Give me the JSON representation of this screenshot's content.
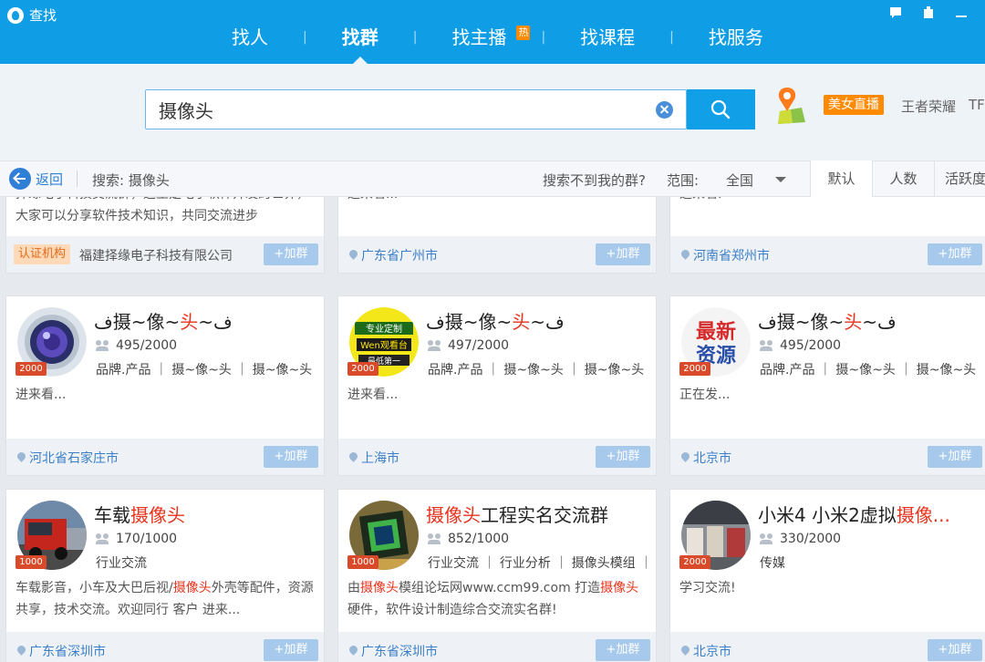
{
  "app": {
    "title": "查找"
  },
  "nav": {
    "items": [
      {
        "label": "找人"
      },
      {
        "label": "找群"
      },
      {
        "label": "找主播",
        "badge": "热"
      },
      {
        "label": "找课程"
      },
      {
        "label": "找服务"
      }
    ],
    "active_index": 1
  },
  "search": {
    "value": "摄像头",
    "placeholder": ""
  },
  "promo": {
    "badge": "美女直播",
    "links": [
      "王者荣耀",
      "TF"
    ]
  },
  "filter": {
    "back_label": "返回",
    "search_term": "搜索: 摄像头",
    "not_found": "搜索不到我的群?",
    "scope_label": "范围:",
    "scope_value": "全国",
    "sort_tabs": [
      "默认",
      "人数",
      "活跃度"
    ]
  },
  "results": {
    "join_label": "+加群",
    "top_row": [
      {
        "desc": "择缘电子科技交流群，这里是电子软件开发的世界，大家可以分享软件技术知识，共同交流进步",
        "cert_badge": "认证机构",
        "org": "福建择缘电子科技有限公司"
      },
      {
        "desc": "进来看...",
        "location": "广东省广州市"
      },
      {
        "desc": "进来看.",
        "location": "河南省郑州市"
      }
    ],
    "groups": [
      {
        "name_parts": [
          "ف摄~像~",
          "头",
          "~ف"
        ],
        "members": "495/2000",
        "tags": "品牌.产品 ｜ 摄~像~头 ｜ 摄~像~头",
        "desc": "进来看...",
        "location": "河北省石家庄市",
        "capacity": "2000"
      },
      {
        "name_parts": [
          "ف摄~像~",
          "头",
          "~ف"
        ],
        "members": "497/2000",
        "tags": "品牌.产品 ｜ 摄~像~头 ｜ 摄~像~头",
        "desc": "进来看...",
        "location": "上海市",
        "capacity": "2000"
      },
      {
        "name_parts": [
          "ف摄~像~",
          "头",
          "~ف"
        ],
        "members": "495/2000",
        "tags": "品牌.产品 ｜ 摄~像~头 ｜ 摄~像~头",
        "desc": "正在发...",
        "location": "北京市",
        "capacity": "2000"
      },
      {
        "name_parts": [
          "车载",
          "摄像头",
          ""
        ],
        "members": "170/1000",
        "tags": "行业交流",
        "desc_parts": [
          "车载影音，小车及大巴后视/",
          "摄像头",
          "外壳等配件，资源共享，技术交流。欢迎同行 客户 进来..."
        ],
        "location": "广东省深圳市",
        "capacity": "1000"
      },
      {
        "name_parts": [
          "",
          "摄像头",
          "工程实名交流群"
        ],
        "members": "852/1000",
        "tags": "行业交流 ｜ 行业分析 ｜ 摄像头模组 ｜...",
        "desc_parts": [
          "由",
          "摄像头",
          "模组论坛网www.ccm99.com 打造",
          "摄像头",
          "硬件，软件设计制造综合交流实名群!"
        ],
        "location": "广东省深圳市",
        "capacity": "1000"
      },
      {
        "name_parts": [
          "小米4 小米2虚拟",
          "摄像...",
          ""
        ],
        "members": "330/2000",
        "tags": "传媒",
        "desc": "学习交流!",
        "location": "北京市",
        "capacity": "2000"
      }
    ],
    "avatar_texts": {
      "card2": [
        "专业定制",
        "Wen观看台",
        "最低第一"
      ],
      "card3": [
        "最新",
        "资源"
      ]
    }
  },
  "colors": {
    "brand_blue": "#0f9ee6",
    "highlight_red": "#e8331c",
    "badge_orange": "#ff8a00",
    "link_blue": "#3a7fc8"
  }
}
